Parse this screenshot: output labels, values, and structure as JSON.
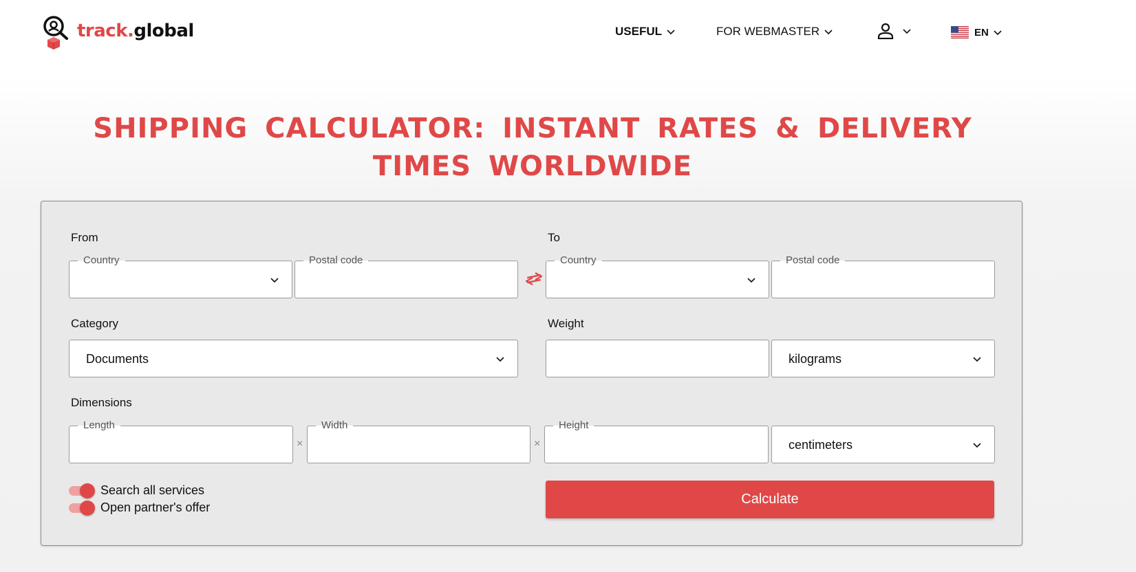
{
  "header": {
    "logo": {
      "part1": "track.",
      "part2": "global"
    },
    "nav": {
      "useful": "USEFUL",
      "webmaster": "FOR WEBMASTER",
      "lang": "EN"
    }
  },
  "title": "SHIPPING CALCULATOR: INSTANT RATES & DELIVERY TIMES WORLDWIDE",
  "form": {
    "from_label": "From",
    "to_label": "To",
    "from_country_legend": "Country",
    "from_postal_legend": "Postal code",
    "to_country_legend": "Country",
    "to_postal_legend": "Postal code",
    "category_label": "Category",
    "category_value": "Documents",
    "weight_label": "Weight",
    "weight_unit": "kilograms",
    "dimensions_label": "Dimensions",
    "length_legend": "Length",
    "width_legend": "Width",
    "height_legend": "Height",
    "times_symbol": "×",
    "dimension_unit": "centimeters",
    "toggle_search_all": "Search all services",
    "toggle_partner": "Open partner's offer",
    "calculate_label": "Calculate"
  },
  "colors": {
    "accent": "#e04848",
    "card_bg": "#e9e9e9"
  }
}
